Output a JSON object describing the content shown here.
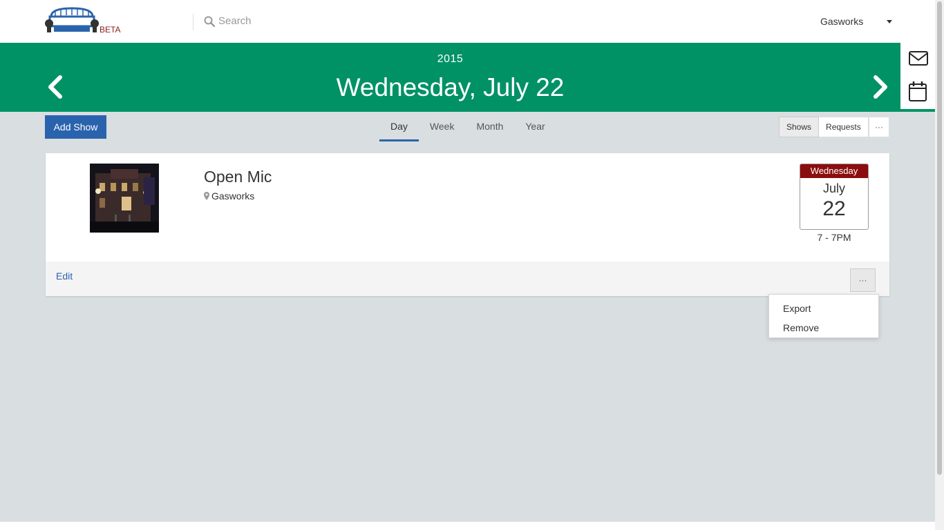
{
  "header": {
    "logo_badge": "BETA",
    "search_placeholder": "Search",
    "account_name": "Gasworks"
  },
  "banner": {
    "year": "2015",
    "date": "Wednesday, July 22",
    "color": "#009265"
  },
  "toolbar": {
    "add_show_label": "Add Show",
    "tabs": [
      {
        "label": "Day",
        "active": true
      },
      {
        "label": "Week",
        "active": false
      },
      {
        "label": "Month",
        "active": false
      },
      {
        "label": "Year",
        "active": false
      }
    ],
    "filter": {
      "shows_label": "Shows",
      "requests_label": "Requests",
      "selected": "Shows"
    },
    "more_label": "···"
  },
  "show": {
    "title": "Open Mic",
    "venue": "Gasworks",
    "calendar": {
      "weekday": "Wednesday",
      "month": "July",
      "day": "22"
    },
    "time": "7 - 7PM",
    "edit_label": "Edit",
    "more_label": "···"
  },
  "menu": {
    "items": [
      "Export",
      "Remove"
    ]
  },
  "colors": {
    "primary": "#2a63ad",
    "accent_green": "#009265",
    "calendar_red": "#8b0d0d",
    "background": "#d9dee1"
  }
}
